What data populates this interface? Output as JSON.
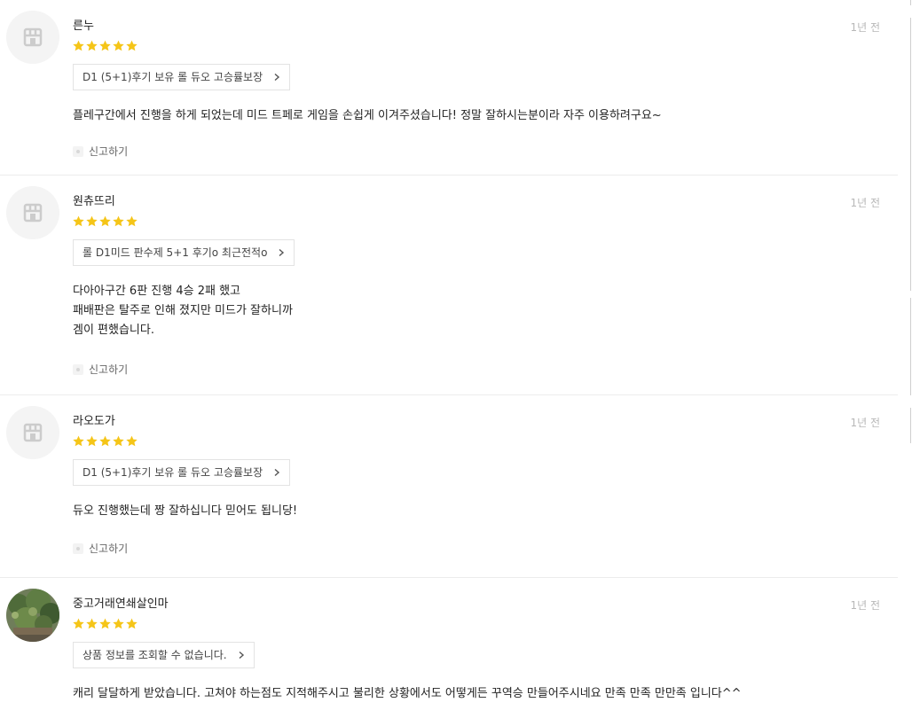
{
  "colors": {
    "star": "#f5c518",
    "time": "#b8b8b8",
    "divider": "#ececec"
  },
  "reviews": [
    {
      "name": "른누",
      "time": "1년 전",
      "rating": 5,
      "product": "D1 (5+1)후기 보유 롤 듀오 고승률보장",
      "content": "플레구간에서 진행을 하게 되었는데 미드 트페로 게임을 손쉽게 이겨주셨습니다! 정말 잘하시는분이라 자주 이용하려구요~",
      "report": "신고하기",
      "avatar_icon": "store-icon"
    },
    {
      "name": "원츄뜨리",
      "time": "1년 전",
      "rating": 5,
      "product": "롤 D1미드 판수제 5+1 후기o 최근전적o",
      "content": "다아아구간 6판 진행 4승 2패 했고\n패배판은 탈주로 인해 졌지만 미드가 잘하니까\n겜이 편했습니다.",
      "report": "신고하기",
      "avatar_icon": "store-icon"
    },
    {
      "name": "라오도가",
      "time": "1년 전",
      "rating": 5,
      "product": "D1 (5+1)후기 보유 롤 듀오 고승률보장",
      "content": "듀오 진행했는데 짱 잘하십니다 믿어도 됩니당!",
      "report": "신고하기",
      "avatar_icon": "store-icon"
    },
    {
      "name": "중고거래연쇄살인마",
      "time": "1년 전",
      "rating": 5,
      "product": "상품 정보를 조회할 수 없습니다.",
      "content": "캐리 달달하게 받았습니다. 고쳐야 하는점도 지적해주시고 불리한 상황에서도 어떻게든 꾸역승 만들어주시네요 만족 만족 만만족 입니다^^",
      "report": "신고하기",
      "avatar_icon": "plant-photo-avatar"
    }
  ]
}
